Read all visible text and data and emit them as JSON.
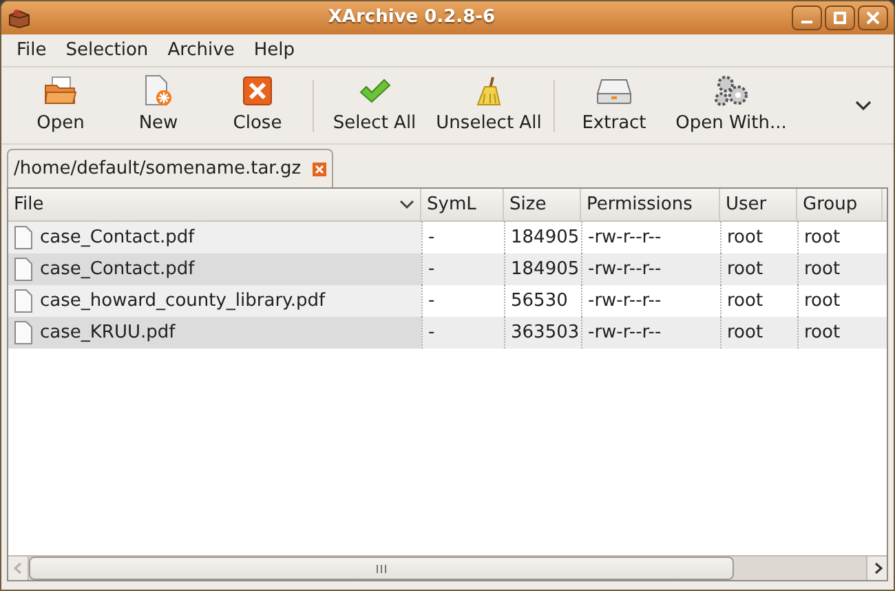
{
  "window": {
    "title": "XArchive 0.2.8-6"
  },
  "menu": [
    "File",
    "Selection",
    "Archive",
    "Help"
  ],
  "toolbar": [
    {
      "kind": "open",
      "label": "Open"
    },
    {
      "kind": "new",
      "label": "New"
    },
    {
      "kind": "close",
      "label": "Close"
    },
    {
      "kind": "separator"
    },
    {
      "kind": "select",
      "label": "Select All"
    },
    {
      "kind": "unselect",
      "label": "Unselect All"
    },
    {
      "kind": "separator"
    },
    {
      "kind": "extract",
      "label": "Extract"
    },
    {
      "kind": "openwith",
      "label": "Open With..."
    }
  ],
  "tabs": [
    {
      "label": "/home/default/somename.tar.gz",
      "selected": true
    }
  ],
  "table": {
    "columns": [
      {
        "label": "File",
        "sorted": true
      },
      {
        "label": "SymL",
        "sorted": false
      },
      {
        "label": "Size",
        "sorted": false
      },
      {
        "label": "Permissions",
        "sorted": false
      },
      {
        "label": "User",
        "sorted": false
      },
      {
        "label": "Group",
        "sorted": false
      }
    ],
    "rows": [
      [
        "case_Contact.pdf",
        "-",
        "184905",
        "-rw-r--r--",
        "root",
        "root"
      ],
      [
        "case_Contact.pdf",
        "-",
        "184905",
        "-rw-r--r--",
        "root",
        "root"
      ],
      [
        "case_howard_county_library.pdf",
        "-",
        "56530",
        "-rw-r--r--",
        "root",
        "root"
      ],
      [
        "case_KRUU.pdf",
        "-",
        "363503",
        "-rw-r--r--",
        "root",
        "root"
      ]
    ]
  }
}
